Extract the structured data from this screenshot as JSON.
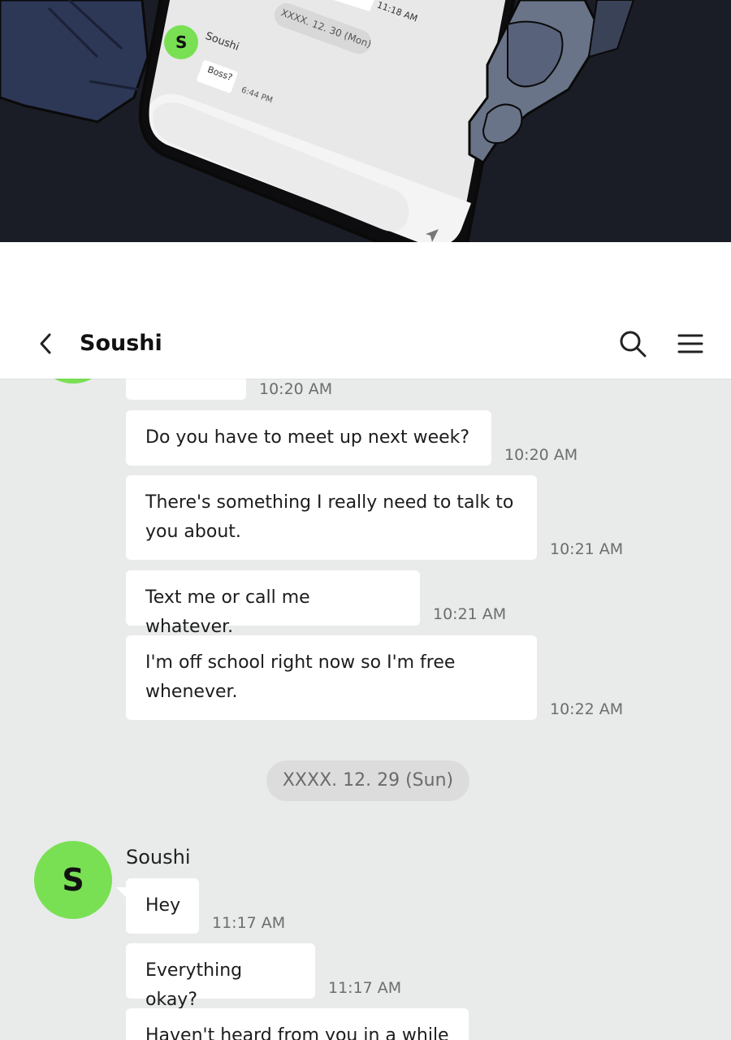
{
  "panel": {
    "phone": {
      "time_top": "11:18 AM",
      "date_pill": "XXXX. 12. 30 (Mon)",
      "avatar_initial": "S",
      "sender": "Soushi",
      "message": "Boss?",
      "message_time": "6:44 PM"
    }
  },
  "header": {
    "title": "Soushi"
  },
  "chat": {
    "messages_before": [
      {
        "time": "10:20 AM"
      },
      {
        "text": "Do you have to meet up next week?",
        "time": "10:20 AM"
      },
      {
        "text": "There's something I really need to talk to you about.",
        "time": "10:21 AM"
      },
      {
        "text": "Text me or call me whatever.",
        "time": "10:21 AM"
      },
      {
        "text": "I'm off school right now so I'm free whenever.",
        "time": "10:22 AM"
      }
    ],
    "date_divider": "XXXX. 12. 29 (Sun)",
    "group": {
      "avatar_initial": "S",
      "sender": "Soushi",
      "messages": [
        {
          "text": "Hey",
          "time": "11:17 AM"
        },
        {
          "text": "Everything okay?",
          "time": "11:17 AM"
        },
        {
          "text": "Haven't heard from you in a while"
        }
      ]
    }
  },
  "colors": {
    "avatar_green": "#79e054",
    "chat_background": "#e9eaea",
    "panel_dark": "#1b1d26"
  },
  "icons": [
    "back-chevron-icon",
    "search-icon",
    "menu-icon",
    "send-icon"
  ]
}
